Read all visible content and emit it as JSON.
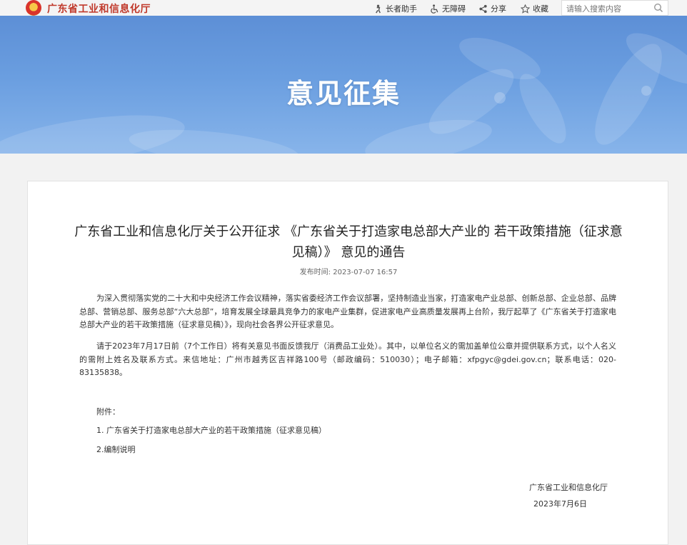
{
  "header": {
    "site_name": "广东省工业和信息化厅",
    "links": [
      {
        "label": "长者助手",
        "icon": "elderly-assist-icon"
      },
      {
        "label": "无障碍",
        "icon": "accessibility-icon"
      },
      {
        "label": "分享",
        "icon": "share-icon"
      },
      {
        "label": "收藏",
        "icon": "star-icon"
      }
    ],
    "search": {
      "placeholder": "请输入搜索内容",
      "value": ""
    }
  },
  "banner": {
    "title": "意见征集"
  },
  "article": {
    "title": "广东省工业和信息化厅关于公开征求 《广东省关于打造家电总部大产业的 若干政策措施（征求意见稿）》 意见的通告",
    "publish_label": "发布时间:",
    "publish_time": "2023-07-07 16:57",
    "paragraphs": [
      "为深入贯彻落实党的二十大和中央经济工作会议精神，落实省委经济工作会议部署，坚持制造业当家，打造家电产业总部、创新总部、企业总部、品牌总部、营销总部、服务总部“六大总部”，培育发展全球最具竞争力的家电产业集群，促进家电产业高质量发展再上台阶，我厅起草了《广东省关于打造家电总部大产业的若干政策措施（征求意见稿）》，现向社会各界公开征求意见。",
      "请于2023年7月17日前（7个工作日）将有关意见书面反馈我厅（消费品工业处）。其中，以单位名义的需加盖单位公章并提供联系方式，以个人名义的需附上姓名及联系方式。来信地址：广州市越秀区吉祥路100号（邮政编码：510030）；电子邮箱：xfpgyc@gdei.gov.cn；联系电话：020-83135838。"
    ],
    "attachments_label": "附件：",
    "attachments": [
      "1. 广东省关于打造家电总部大产业的若干政策措施（征求意见稿）",
      "2.编制说明"
    ],
    "signature": "广东省工业和信息化厅",
    "date": "2023年7月6日"
  },
  "colors": {
    "brand": "#c0392b",
    "banner": "#6a9ee0"
  }
}
